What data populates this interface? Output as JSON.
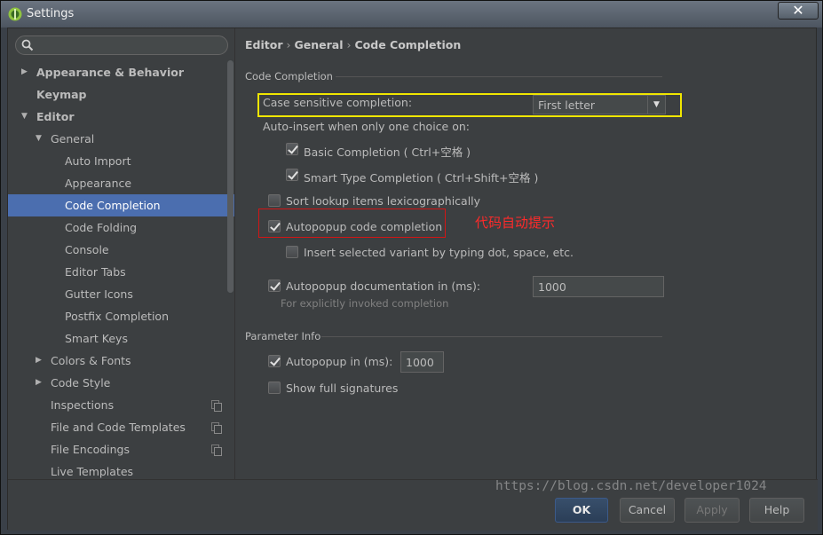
{
  "window": {
    "title": "Settings",
    "close_glyph": "✕"
  },
  "sidebar": {
    "search": {
      "placeholder": "",
      "value": ""
    },
    "items": [
      {
        "label": "Appearance & Behavior",
        "level": 0,
        "arrow": "right",
        "bold": true
      },
      {
        "label": "Keymap",
        "level": 0,
        "arrow": "none",
        "bold": true
      },
      {
        "label": "Editor",
        "level": 0,
        "arrow": "down",
        "bold": true
      },
      {
        "label": "General",
        "level": 1,
        "arrow": "down"
      },
      {
        "label": "Auto Import",
        "level": 2
      },
      {
        "label": "Appearance",
        "level": 2
      },
      {
        "label": "Code Completion",
        "level": 2,
        "selected": true
      },
      {
        "label": "Code Folding",
        "level": 2
      },
      {
        "label": "Console",
        "level": 2
      },
      {
        "label": "Editor Tabs",
        "level": 2
      },
      {
        "label": "Gutter Icons",
        "level": 2
      },
      {
        "label": "Postfix Completion",
        "level": 2
      },
      {
        "label": "Smart Keys",
        "level": 2
      },
      {
        "label": "Colors & Fonts",
        "level": 1,
        "arrow": "right"
      },
      {
        "label": "Code Style",
        "level": 1,
        "arrow": "right"
      },
      {
        "label": "Inspections",
        "level": 1,
        "copy_icon": true
      },
      {
        "label": "File and Code Templates",
        "level": 1,
        "copy_icon": true
      },
      {
        "label": "File Encodings",
        "level": 1,
        "copy_icon": true
      },
      {
        "label": "Live Templates",
        "level": 1
      }
    ]
  },
  "breadcrumb": {
    "part1": "Editor",
    "part2": "General",
    "part3": "Code Completion",
    "separator": "›"
  },
  "code_completion": {
    "section_title": "Code Completion",
    "case_sensitive_label": "Case sensitive completion:",
    "case_sensitive_value": "First letter",
    "auto_insert_label": "Auto-insert when only one choice on:",
    "basic_completion": {
      "label": "Basic Completion ( Ctrl+空格 )",
      "checked": true
    },
    "smart_type_completion": {
      "label": "Smart Type Completion ( Ctrl+Shift+空格 )",
      "checked": true
    },
    "sort_lexicographically": {
      "label": "Sort lookup items lexicographically",
      "checked": false
    },
    "autopopup_completion": {
      "label": "Autopopup code completion",
      "checked": true
    },
    "insert_selected_variant": {
      "label": "Insert selected variant by typing dot, space, etc.",
      "checked": false
    },
    "autopopup_documentation": {
      "label": "Autopopup documentation in (ms):",
      "checked": true,
      "value": "1000"
    },
    "documentation_hint": "For explicitly invoked completion",
    "annotation": "代码自动提示"
  },
  "parameter_info": {
    "section_title": "Parameter Info",
    "autopopup": {
      "label": "Autopopup in (ms):",
      "checked": true,
      "value": "1000"
    },
    "show_full_signatures": {
      "label": "Show full signatures",
      "checked": false
    }
  },
  "footer": {
    "ok": "OK",
    "cancel": "Cancel",
    "apply": "Apply",
    "help": "Help"
  },
  "watermark": "https://blog.csdn.net/developer1024",
  "colors": {
    "selection": "#4b6eaf",
    "highlight_yellow": "#f0e600",
    "highlight_red": "#d31515",
    "annotation_red": "#ff2a2a"
  }
}
